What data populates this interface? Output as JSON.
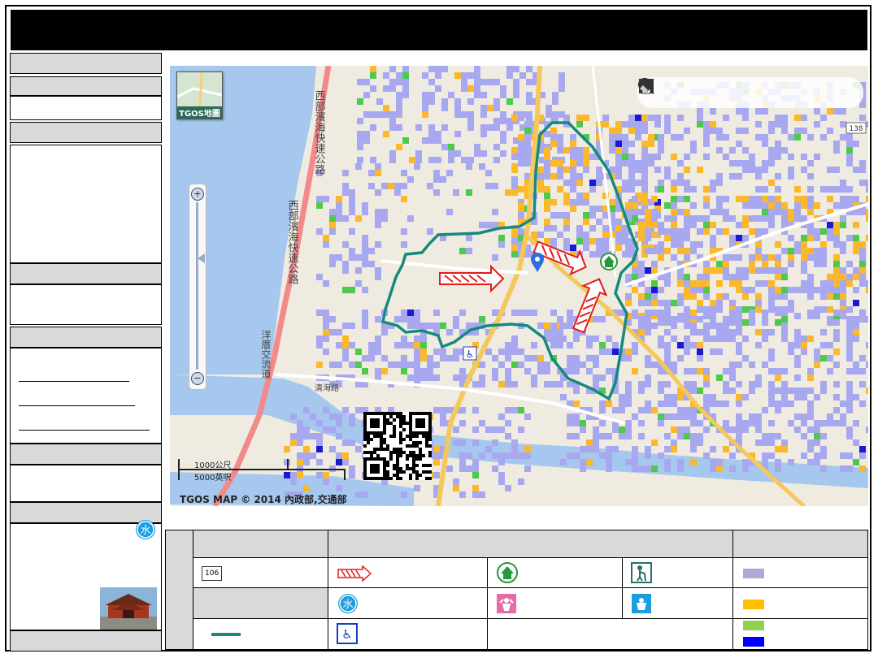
{
  "map": {
    "thumbnail_label": "TGOS地圖",
    "scale_metric": "1000公尺",
    "scale_imperial": "5000英呎",
    "copyright": "TGOS MAP © 2014 內政部,交通部",
    "road_labels": [
      "西部濱海快速公路",
      "西部濱海快速公路",
      "洋厝交流道",
      "清海路"
    ],
    "highway_shield": "138",
    "zoom_in": "+",
    "zoom_out": "−"
  },
  "toolbar": {
    "tools": [
      "pan-tool",
      "zoom-in-tool",
      "zoom-out-tool",
      "full-extent-tool",
      "measure-line-tool",
      "measure-area-tool",
      "print-tool",
      "clear-tool"
    ]
  },
  "legend": {
    "route_shield": "106",
    "water_symbol": "水"
  },
  "colors": {
    "purple": "#a8a8f0",
    "orange": "#fbb82a",
    "green": "#4ec94e",
    "blue": "#1a1ad4",
    "boundary": "#158a7c",
    "arrow": "#e21b1b",
    "legend_purple": "#b4a7d6",
    "legend_orange": "#ffc000",
    "legend_green": "#92d050",
    "legend_blue": "#0000ff"
  }
}
